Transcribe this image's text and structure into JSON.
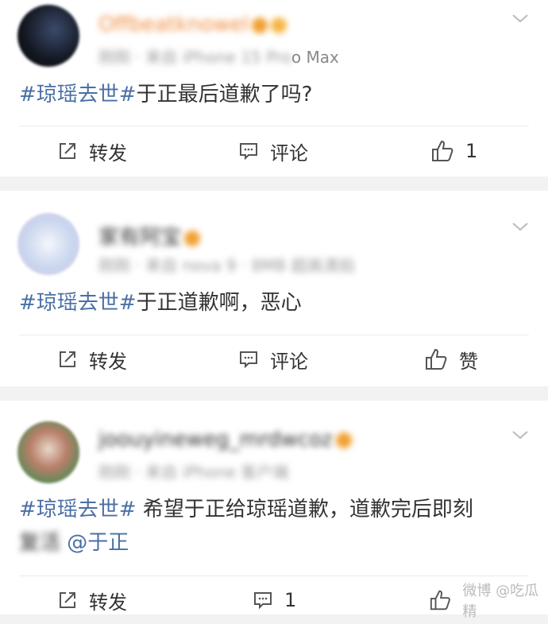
{
  "posts": [
    {
      "username": "Offbeatknowel",
      "meta_blurred": "刚刚 · 来自 iPhone 15 Pro",
      "meta_visible": "o Max",
      "topic": "#琼瑶去世#",
      "text": "于正最后道歉了吗?",
      "actions": {
        "repost": "转发",
        "comment": "评论",
        "like": "1"
      }
    },
    {
      "username": "家有阿宝",
      "meta_blurred": "刚刚 · 来自 nova 9 · 8MB 超高清拍",
      "topic": "#琼瑶去世#",
      "text": "于正道歉啊，恶心",
      "actions": {
        "repost": "转发",
        "comment": "评论",
        "like": "赞"
      }
    },
    {
      "username": "joouyineweg_mrdwcoz",
      "meta_blurred": "刚刚 · 来自 iPhone 客户端",
      "topic": "#琼瑶去世#",
      "text": " 希望于正给琼瑶道歉，道歉完后即刻",
      "text2_blurred": "复活",
      "mention": "@于正",
      "actions": {
        "repost": "转发",
        "comment": "1",
        "like": ""
      }
    }
  ],
  "watermark": "微博 @吃瓜精"
}
